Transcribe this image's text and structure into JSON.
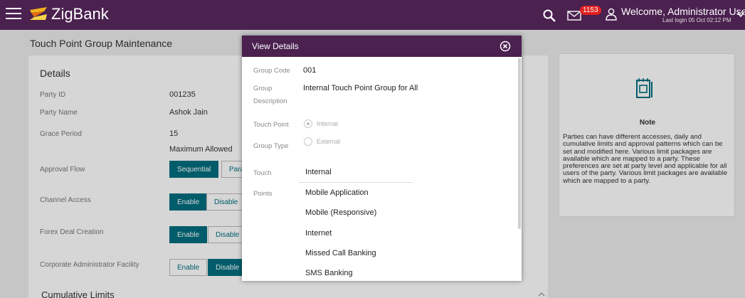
{
  "topbar": {
    "brand": "ZigBank",
    "notification_count": "1153",
    "welcome": "Welcome, Administrator User",
    "last_login": "Last login 05 Oct 02:12 PM"
  },
  "page": {
    "title": "Touch Point Group Maintenance"
  },
  "details": {
    "title": "Details",
    "party_id_label": "Party ID",
    "party_id": "001235",
    "party_name_label": "Party Name",
    "party_name": "Ashok Jain",
    "grace_period_label": "Grace Period",
    "grace_period": "15",
    "grace_sub": "Maximum Allowed",
    "approval_flow_label": "Approval Flow",
    "approval_options": [
      "Sequential",
      "Para"
    ],
    "channel_access_label": "Channel Access",
    "forex_label": "Forex Deal Creation",
    "corp_admin_label": "Corporate Administrator Facility",
    "enable_label": "Enable",
    "disable_label": "Disable",
    "cumulative_limits": "Cumulative Limits"
  },
  "note": {
    "title": "Note",
    "text": "Parties can have different accesses, daily and cumulative limits and approval patterns which can be set and modified here. Various limit packages are available which are mapped to a party. These preferences are set at party level and applicable for all users of the party. Various limit packages are available which are mapped to a party."
  },
  "modal": {
    "title": "View Details",
    "group_code_label": "Group Code",
    "group_code": "001",
    "group_desc_label_1": "Group",
    "group_desc_label_2": "Description",
    "group_desc": "Internal Touch Point Group for All",
    "touch_point_label": "Touch Point",
    "group_type_label": "Group Type",
    "radio_internal": "Internal",
    "radio_external": "External",
    "touch_points_label_1": "Touch",
    "touch_points_label_2": "Points",
    "touch_points": [
      "Internal",
      "Mobile Application",
      "Mobile (Responsive)",
      "Internet",
      "Missed Call Banking",
      "SMS Banking"
    ]
  }
}
